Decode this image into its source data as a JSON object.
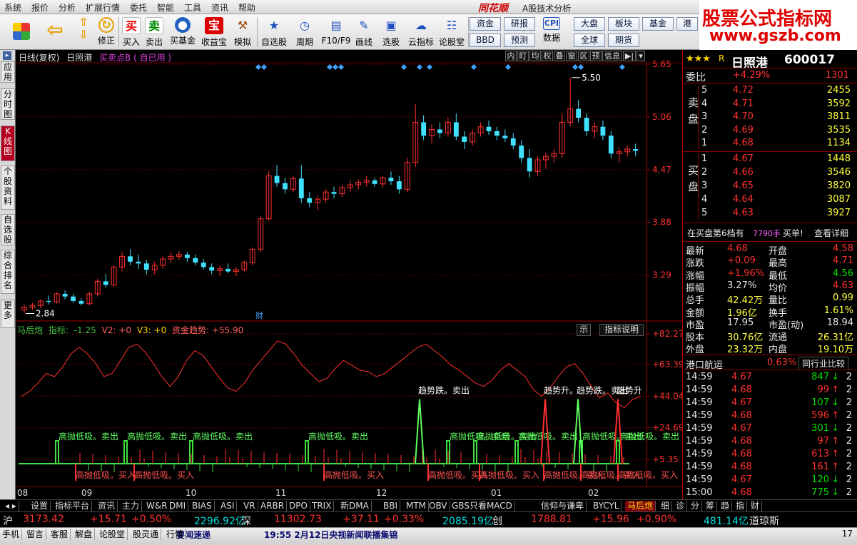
{
  "menu": [
    "系统",
    "报价",
    "分析",
    "扩展行情",
    "委托",
    "智能",
    "工具",
    "资讯",
    "帮助"
  ],
  "brand": "同花顺",
  "window_title": "A股技术分析",
  "logo": {
    "line1": "股票公式指标网",
    "line2": "www.gszb.com"
  },
  "toolbar": [
    "修正",
    "买入",
    "卖出",
    "买基金",
    "收益宝",
    "模拟",
    "自选股",
    "周期",
    "F10/F9",
    "画线",
    "选股",
    "云指标",
    "论股堂",
    "数据"
  ],
  "toolbar_icons": [
    "买",
    "卖",
    "宝"
  ],
  "small_buttons": [
    "资金",
    "BBD",
    "研报",
    "预测",
    "大盘",
    "全球",
    "板块",
    "期货",
    "基金",
    "港"
  ],
  "left_tabs": [
    "应用",
    "分时图",
    "K线图",
    "个股资料",
    "自选股",
    "综合排名",
    "更多"
  ],
  "chart": {
    "title": "日线(复权)",
    "name": "日照港",
    "formula": "买卖点B ( 自已用 )",
    "tools": [
      "内",
      "盯",
      "均",
      "权",
      "叠",
      "窗",
      "区",
      "预",
      "信息"
    ],
    "price_axis": [
      "5.65",
      "5.06",
      "4.47",
      "3.88",
      "3.29"
    ],
    "high_label": "5.50",
    "low_label": "2.84",
    "cai": "财",
    "indicator_name": "马后炮",
    "indicator_label": "指标:",
    "indicator_v1": "-1.25",
    "indicator_v2": "V2: +0",
    "indicator_v3": "V3: +0",
    "indicator_v4": "资金趋势: +55.90",
    "ind_axis": [
      "+82.27",
      "+63.39",
      "+44.04",
      "+24.69",
      "+5.35"
    ],
    "ind_btn1": "示",
    "ind_btn2": "指标说明",
    "sig_sell": "高抛低吸。卖出",
    "sig_buy": "高抛低吸。买入",
    "sig_down": "趋势跌。卖出",
    "sig_up": "趋势升。",
    "sig_up2": "趋势升",
    "dates": [
      "08",
      "09",
      "10",
      "11",
      "12",
      "01",
      "02"
    ]
  },
  "chart_data": {
    "type": "candlestick",
    "categories_months": [
      "08",
      "09",
      "10",
      "11",
      "12",
      "01",
      "02"
    ],
    "ylim": [
      2.84,
      5.65
    ],
    "high": 5.5,
    "low": 2.84,
    "ohlc": [
      [
        2.9,
        2.96,
        2.86,
        2.93
      ],
      [
        2.93,
        2.98,
        2.9,
        2.95
      ],
      [
        2.95,
        3.02,
        2.92,
        3.0
      ],
      [
        3.0,
        3.06,
        2.96,
        2.99
      ],
      [
        2.99,
        3.1,
        2.97,
        3.08
      ],
      [
        3.08,
        3.12,
        3.02,
        3.05
      ],
      [
        3.05,
        3.08,
        2.98,
        3.0
      ],
      [
        3.0,
        3.03,
        2.95,
        2.97
      ],
      [
        2.97,
        3.1,
        2.95,
        3.08
      ],
      [
        3.08,
        3.25,
        3.05,
        3.22
      ],
      [
        3.22,
        3.3,
        3.15,
        3.18
      ],
      [
        3.18,
        3.4,
        3.16,
        3.38
      ],
      [
        3.38,
        3.55,
        3.33,
        3.5
      ],
      [
        3.5,
        3.58,
        3.4,
        3.44
      ],
      [
        3.44,
        3.52,
        3.36,
        3.42
      ],
      [
        3.42,
        3.46,
        3.3,
        3.35
      ],
      [
        3.35,
        3.44,
        3.3,
        3.4
      ],
      [
        3.4,
        3.5,
        3.36,
        3.47
      ],
      [
        3.47,
        3.55,
        3.43,
        3.5
      ],
      [
        3.5,
        3.56,
        3.46,
        3.52
      ],
      [
        3.52,
        3.55,
        3.44,
        3.48
      ],
      [
        3.48,
        3.52,
        3.4,
        3.43
      ],
      [
        3.43,
        3.47,
        3.35,
        3.38
      ],
      [
        3.38,
        3.42,
        3.3,
        3.34
      ],
      [
        3.34,
        3.4,
        3.28,
        3.36
      ],
      [
        3.36,
        3.42,
        3.31,
        3.33
      ],
      [
        3.33,
        3.38,
        3.28,
        3.35
      ],
      [
        3.35,
        3.45,
        3.33,
        3.43
      ],
      [
        3.43,
        3.6,
        3.4,
        3.58
      ],
      [
        3.58,
        3.95,
        3.55,
        3.92
      ],
      [
        3.92,
        4.45,
        3.9,
        4.4
      ],
      [
        4.4,
        4.52,
        4.28,
        4.32
      ],
      [
        4.32,
        4.38,
        4.2,
        4.25
      ],
      [
        4.25,
        4.4,
        4.22,
        4.37
      ],
      [
        4.37,
        4.52,
        4.1,
        4.15
      ],
      [
        4.15,
        4.22,
        4.05,
        4.1
      ],
      [
        4.1,
        4.18,
        4.02,
        4.14
      ],
      [
        4.14,
        4.25,
        4.1,
        4.22
      ],
      [
        4.22,
        4.28,
        4.15,
        4.2
      ],
      [
        4.2,
        4.3,
        4.16,
        4.27
      ],
      [
        4.27,
        4.35,
        4.22,
        4.3
      ],
      [
        4.3,
        4.36,
        4.25,
        4.33
      ],
      [
        4.33,
        4.4,
        4.28,
        4.35
      ],
      [
        4.35,
        4.38,
        4.28,
        4.31
      ],
      [
        4.31,
        4.4,
        4.27,
        4.38
      ],
      [
        4.38,
        4.45,
        4.3,
        4.34
      ],
      [
        4.34,
        4.4,
        4.2,
        4.25
      ],
      [
        4.25,
        4.6,
        4.22,
        4.55
      ],
      [
        4.55,
        5.2,
        4.5,
        5.0
      ],
      [
        5.0,
        5.08,
        4.8,
        4.85
      ],
      [
        4.85,
        4.98,
        4.76,
        4.92
      ],
      [
        4.92,
        5.0,
        4.82,
        4.88
      ],
      [
        4.88,
        5.05,
        4.84,
        5.0
      ],
      [
        5.0,
        5.1,
        4.8,
        4.84
      ],
      [
        4.84,
        4.9,
        4.7,
        4.78
      ],
      [
        4.78,
        4.92,
        4.74,
        4.88
      ],
      [
        4.88,
        5.0,
        4.84,
        4.95
      ],
      [
        4.95,
        5.02,
        4.86,
        4.9
      ],
      [
        4.9,
        4.95,
        4.8,
        4.85
      ],
      [
        4.85,
        4.92,
        4.78,
        4.82
      ],
      [
        4.82,
        4.88,
        4.7,
        4.74
      ],
      [
        4.74,
        4.8,
        4.55,
        4.6
      ],
      [
        4.6,
        4.7,
        4.38,
        4.45
      ],
      [
        4.45,
        4.62,
        4.4,
        4.58
      ],
      [
        4.58,
        4.66,
        4.48,
        4.62
      ],
      [
        4.62,
        4.7,
        4.55,
        4.65
      ],
      [
        4.65,
        5.1,
        4.6,
        5.0
      ],
      [
        5.0,
        5.5,
        4.95,
        5.15
      ],
      [
        5.15,
        5.25,
        5.0,
        5.05
      ],
      [
        5.05,
        5.1,
        4.85,
        4.9
      ],
      [
        4.9,
        5.0,
        4.82,
        4.95
      ],
      [
        4.95,
        5.02,
        4.8,
        4.85
      ],
      [
        4.85,
        4.9,
        4.6,
        4.65
      ],
      [
        4.65,
        4.72,
        4.55,
        4.67
      ],
      [
        4.67,
        4.74,
        4.62,
        4.7
      ],
      [
        4.7,
        4.76,
        4.62,
        4.68
      ]
    ],
    "indicator_line": [
      44,
      47,
      52,
      58,
      56,
      62,
      70,
      74,
      70,
      64,
      56,
      58,
      66,
      74,
      76,
      71,
      64,
      56,
      50,
      56,
      66,
      72,
      69,
      62,
      55,
      49,
      47,
      52,
      60,
      66,
      72,
      78,
      76,
      70,
      63,
      58,
      53,
      55,
      61,
      66,
      63,
      60,
      59,
      56,
      58,
      62,
      66,
      70,
      74,
      76,
      72,
      68,
      63,
      60,
      56,
      52,
      50,
      54,
      60,
      64,
      60,
      56,
      48,
      44,
      49,
      56,
      62,
      64,
      58,
      50,
      43,
      46,
      40,
      37,
      42,
      44
    ]
  },
  "right": {
    "stars": "★★★",
    "r_badge": "R",
    "name": "日照港",
    "code": "600017",
    "wb_label": "委比",
    "wb_pct": "+4.29%",
    "wb_val": "1301",
    "sell_label": "卖盘",
    "buy_label": "买盘",
    "asks": [
      [
        "5",
        "4.72",
        "2455"
      ],
      [
        "4",
        "4.71",
        "3592"
      ],
      [
        "3",
        "4.70",
        "3811"
      ],
      [
        "2",
        "4.69",
        "3535"
      ],
      [
        "1",
        "4.68",
        "1134"
      ]
    ],
    "bids": [
      [
        "1",
        "4.67",
        "1448"
      ],
      [
        "2",
        "4.66",
        "3546"
      ],
      [
        "3",
        "4.65",
        "3820"
      ],
      [
        "4",
        "4.64",
        "3087"
      ],
      [
        "5",
        "4.63",
        "3927"
      ]
    ],
    "info_left": "在买盘第6档有",
    "info_vol": "7790手",
    "info_mid": "买单!",
    "info_right": "查看详细",
    "quotes": [
      [
        "最新",
        "4.68",
        "开盘",
        "4.58"
      ],
      [
        "涨跌",
        "+0.09",
        "最高",
        "4.71"
      ],
      [
        "涨幅",
        "+1.96%",
        "最低",
        "4.56"
      ],
      [
        "振幅",
        "3.27%",
        "均价",
        "4.63"
      ],
      [
        "总手",
        "42.42万",
        "量比",
        "0.99"
      ],
      [
        "金额",
        "1.96亿",
        "换手",
        "1.61%"
      ],
      [
        "市盈",
        "17.95",
        "市盈(动)",
        "18.94"
      ],
      [
        "股本",
        "30.76亿",
        "流通",
        "26.31亿"
      ],
      [
        "外盘",
        "23.32万",
        "内盘",
        "19.10万"
      ]
    ],
    "sector": "港口航运",
    "sector_pct": "0.63%",
    "compare": "同行业比较",
    "ticks": [
      [
        "14:59",
        "4.67",
        "847",
        "2"
      ],
      [
        "14:59",
        "4.68",
        "99",
        "2"
      ],
      [
        "14:59",
        "4.67",
        "107",
        "2"
      ],
      [
        "14:59",
        "4.68",
        "596",
        "2"
      ],
      [
        "14:59",
        "4.67",
        "301",
        "2"
      ],
      [
        "14:59",
        "4.68",
        "97",
        "2"
      ],
      [
        "14:59",
        "4.68",
        "613",
        "2"
      ],
      [
        "14:59",
        "4.68",
        "161",
        "2"
      ],
      [
        "14:59",
        "4.67",
        "120",
        "2"
      ],
      [
        "15:00",
        "4.68",
        "775",
        "2"
      ]
    ]
  },
  "bottom_tabs": [
    "设置",
    "指标平台",
    "资讯",
    "主力",
    "W&R",
    "DMI",
    "BIAS",
    "ASI",
    "VR",
    "ARBR",
    "DPO",
    "TRIX",
    "新DMA",
    "BBI",
    "MTM",
    "OBV",
    "GBS只看MACD",
    "信仰与谦卑",
    "BYCYL",
    "马后炮",
    "细",
    "诊",
    "分",
    "筹",
    "趋",
    "指",
    "财"
  ],
  "status": {
    "sh": "沪",
    "sh_idx": "3173.42",
    "sh_chg": "+15.71",
    "sh_pct": "+0.50%",
    "sh_amt": "2296.92亿",
    "sz": "深",
    "sz_idx": "11302.73",
    "sz_chg": "+37.11",
    "sz_pct": "+0.33%",
    "sz_amt": "2085.19亿",
    "cy": "创",
    "cy_idx": "1788.81",
    "cy_chg": "+15.96",
    "cy_pct": "+0.90%",
    "cy_amt": "481.14亿",
    "dj": "道琼斯"
  },
  "bottom": {
    "items": [
      "手机",
      "留言",
      "客服",
      "解盘",
      "论股堂",
      "股灵通",
      "行情"
    ],
    "news1": "要闻速递",
    "news2": "19:55 2月12日央视新闻联播集锦",
    "num": "17"
  }
}
